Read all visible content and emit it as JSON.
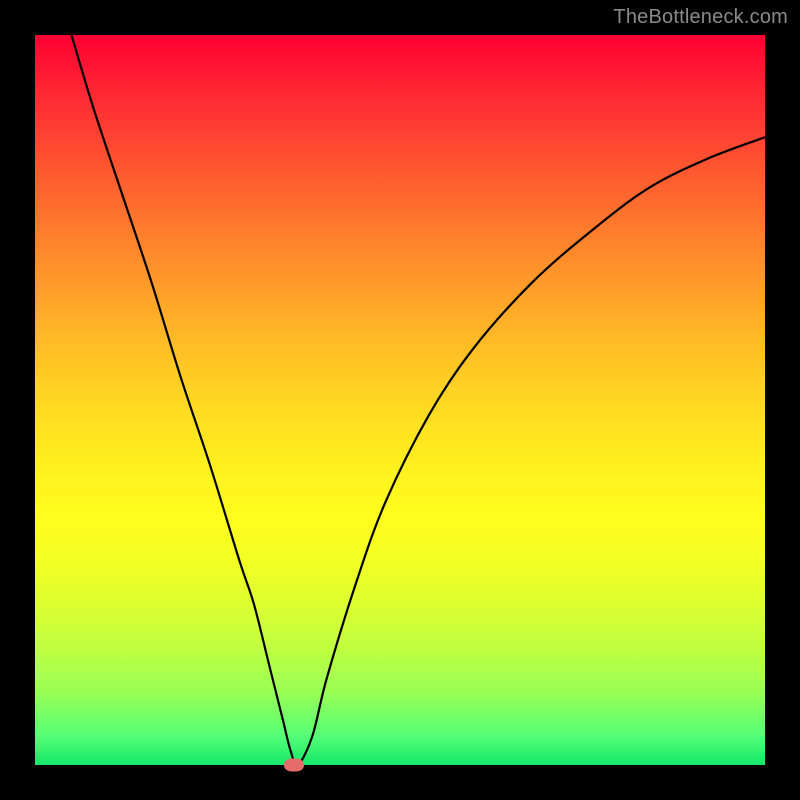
{
  "watermark": "TheBottleneck.com",
  "chart_data": {
    "type": "line",
    "title": "",
    "xlabel": "",
    "ylabel": "",
    "xlim": [
      0,
      100
    ],
    "ylim": [
      0,
      100
    ],
    "grid": false,
    "legend": false,
    "series": [
      {
        "name": "curve",
        "color": "#000000",
        "x": [
          5,
          8,
          12,
          16,
          20,
          24,
          28,
          30,
          32,
          33,
          34,
          35,
          36,
          38,
          40,
          44,
          48,
          54,
          60,
          68,
          76,
          84,
          92,
          100
        ],
        "y": [
          100,
          90,
          78,
          66,
          53,
          41,
          28,
          22,
          14,
          10,
          6,
          2,
          0,
          4,
          12,
          25,
          36,
          48,
          57,
          66,
          73,
          79,
          83,
          86
        ]
      }
    ],
    "marker": {
      "x": 35.5,
      "y": 0,
      "color": "#e86b6b"
    }
  }
}
